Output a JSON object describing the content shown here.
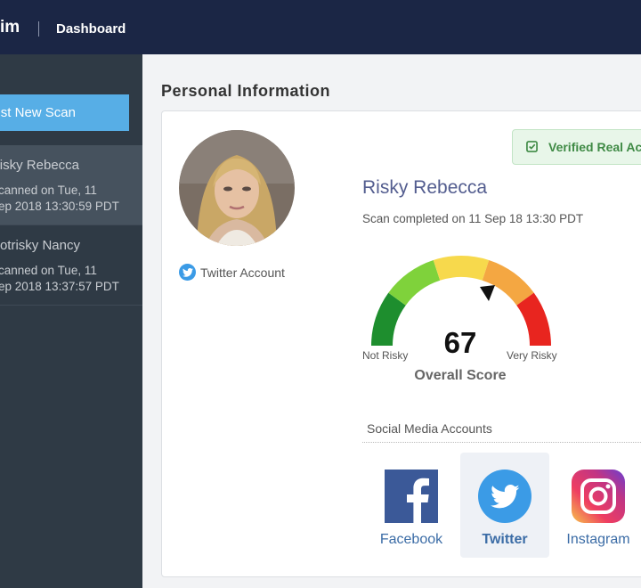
{
  "header": {
    "brand_partial": "im",
    "nav_title": "Dashboard"
  },
  "sidebar": {
    "new_scan_label": "st New Scan",
    "scans": [
      {
        "name": "isky Rebecca",
        "meta_line1": "canned on Tue, 11",
        "meta_line2": "ep 2018 13:30:59 PDT"
      },
      {
        "name": "otrisky Nancy",
        "meta_line1": "canned on Tue, 11",
        "meta_line2": "ep 2018 13:37:57 PDT"
      }
    ]
  },
  "main": {
    "section_title": "Personal Information",
    "twitter_account_label": "Twitter Account",
    "verified_label": "Verified Real Ac",
    "person_name": "Risky Rebecca",
    "scan_completed": "Scan completed on 11 Sep 18 13:30 PDT",
    "gauge": {
      "score": "67",
      "score_label": "Overall Score",
      "left_label": "Not Risky",
      "right_label": "Very Risky",
      "colors": [
        "#1e8e2e",
        "#7fd23b",
        "#f7d94c",
        "#f4a742",
        "#e8251f"
      ]
    },
    "social": {
      "heading": "Social Media Accounts",
      "accounts": [
        {
          "label": "Facebook",
          "icon": "facebook-icon",
          "color": "#3b5998"
        },
        {
          "label": "Twitter",
          "icon": "twitter-icon",
          "color": "#3b9be6"
        },
        {
          "label": "Instagram",
          "icon": "instagram-icon",
          "color": "#c13584"
        }
      ]
    }
  }
}
